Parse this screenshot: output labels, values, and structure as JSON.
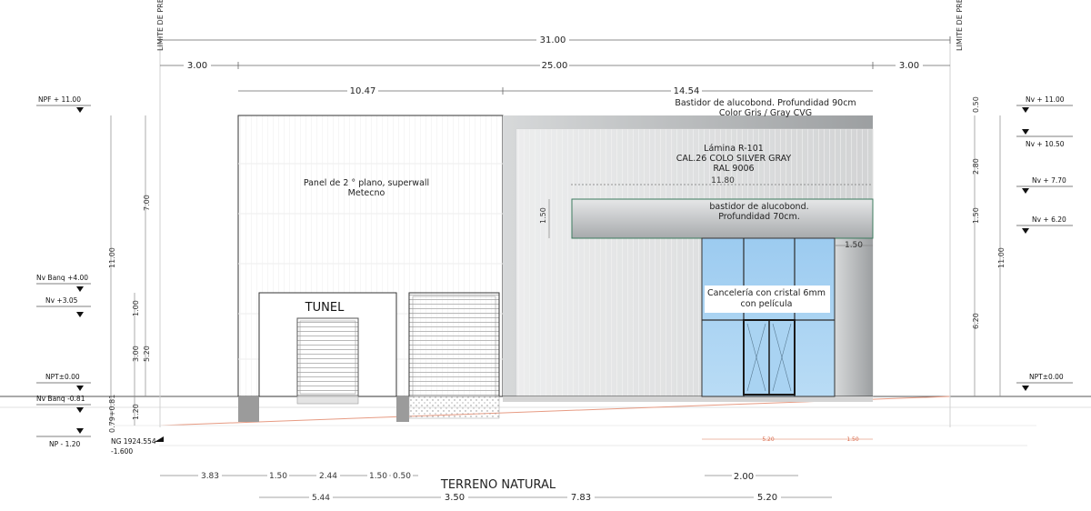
{
  "limits": {
    "left": "LIMITE DE PREDIO",
    "right": "LIMITE DE PREDIO"
  },
  "top_dims": {
    "total": "31.00",
    "left_setback": "3.00",
    "building": "25.00",
    "right_setback": "3.00",
    "left_block": "10.47",
    "right_block": "14.54",
    "canopy": "11.80"
  },
  "notes": {
    "bastidor_90_line1": "Bastidor de alucobond. Profundidad 90cm",
    "bastidor_90_line2": "Color  Gris / Gray CVG",
    "lamina_line1": "Lámina R-101",
    "lamina_line2": "CAL.26 COLO SILVER GRAY",
    "lamina_line3": "RAL 9006",
    "panel_line1": "Panel de 2 ° plano, superwall",
    "panel_line2": "Metecno",
    "bastidor_70_line1": "bastidor de alucobond.",
    "bastidor_70_line2": "Profundidad 70cm.",
    "tunel": "TUNEL",
    "canceleria_line1": "Cancelería con cristal 6mm",
    "canceleria_line2": "con película",
    "terreno": "TERRENO NATURAL"
  },
  "left_levels": {
    "npf": "NPF + 11.00",
    "nv_banq_4": "Nv Banq +4.00",
    "nv_305": "Nv +3.05",
    "npt": "NPT±0.00",
    "nv_banq_neg": "Nv Banq -0.81",
    "np_neg": "NP - 1.20",
    "ng": "NG 1924.554",
    "ng_sub": "-1.600"
  },
  "right_levels": {
    "nv_1100": "Nv + 11.00",
    "nv_1050": "Nv + 10.50",
    "nv_770": "Nv + 7.70",
    "nv_620": "Nv + 6.20",
    "npt": "NPT±0.00"
  },
  "left_vdims": {
    "total": "11.00",
    "seven": "7.00",
    "one": "1.00",
    "three": "3.00",
    "five_twenty": "5.20",
    "one_twenty": "1.20",
    "small": "0.79+0.81"
  },
  "right_vdims": {
    "total": "11.00",
    "half": "0.50",
    "two_eighty": "2.80",
    "one_fifty": "1.50",
    "six_twenty": "6.20"
  },
  "canopy_dims": {
    "height": "1.50",
    "side": "1.50"
  },
  "bottom_dims": {
    "a": "3.83",
    "b": "1.50",
    "c": "2.44",
    "d": "1.50",
    "e": "0.50",
    "f": "2.00",
    "g": "5.44",
    "h": "3.50",
    "i": "7.83",
    "j": "5.20",
    "red_a": "5.20",
    "red_b": "1.50"
  },
  "colors": {
    "glass": "#a9d3f2",
    "panel_gray": "#c7c9ca",
    "line": "#2a2a2a",
    "dim_line": "#555555",
    "red_dim": "#d9694a"
  }
}
